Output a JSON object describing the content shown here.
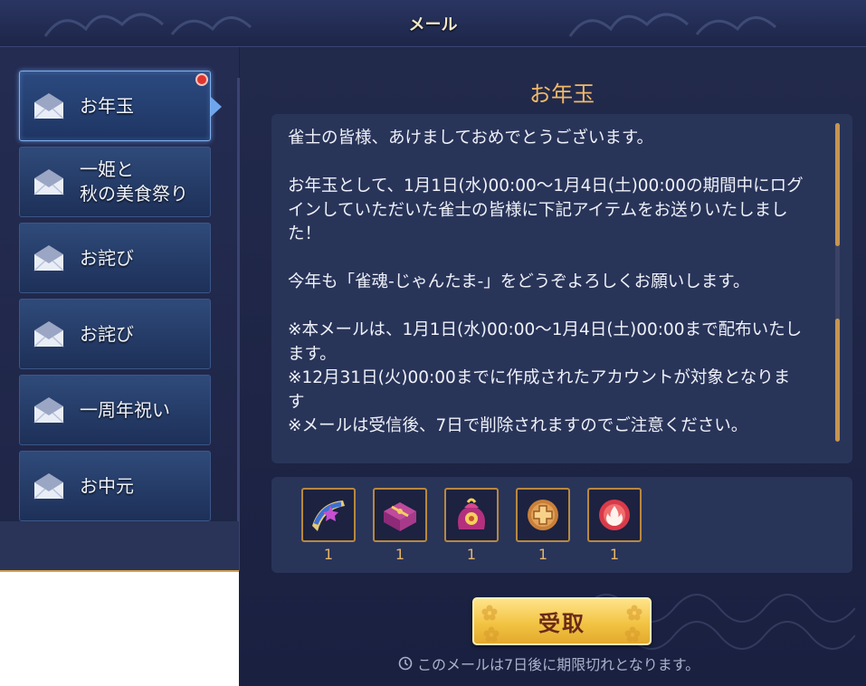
{
  "header": {
    "title": "メール"
  },
  "sidebar": {
    "items": [
      {
        "label": "お年玉",
        "selected": true,
        "unread": true
      },
      {
        "label": "一姫と\n秋の美食祭り",
        "selected": false,
        "unread": false
      },
      {
        "label": "お詫び",
        "selected": false,
        "unread": false
      },
      {
        "label": "お詫び",
        "selected": false,
        "unread": false
      },
      {
        "label": "一周年祝い",
        "selected": false,
        "unread": false
      },
      {
        "label": "お中元",
        "selected": false,
        "unread": false
      }
    ]
  },
  "mail": {
    "title": "お年玉",
    "body": "雀士の皆様、あけましておめでとうございます。\n\nお年玉として、1月1日(水)00:00～1月4日(土)00:00の期間中にログインしていただいた雀士の皆様に下記アイテムをお送りいたしました！\n\n今年も「雀魂-じゃんたま-」をどうぞよろしくお願いします。\n\n※本メールは、1月1日(水)00:00～1月4日(土)00:00まで配布いたします。\n※12月31日(火)00:00までに作成されたアカウントが対象となります\n※メールは受信後、7日で削除されますのでご注意ください。",
    "rewards": [
      {
        "icon": "scroll-ticket-icon",
        "qty": "1"
      },
      {
        "icon": "gift-box-icon",
        "qty": "1"
      },
      {
        "icon": "lucky-bag-icon",
        "qty": "1"
      },
      {
        "icon": "bronze-coin-icon",
        "qty": "1"
      },
      {
        "icon": "fire-orb-icon",
        "qty": "1"
      }
    ],
    "claim_label": "受取",
    "expiry_text": "このメールは7日後に期限切れとなります。"
  },
  "colors": {
    "accent_gold": "#f1b968",
    "unread_red": "#e0342e",
    "button_yellow": "#f2c444"
  }
}
